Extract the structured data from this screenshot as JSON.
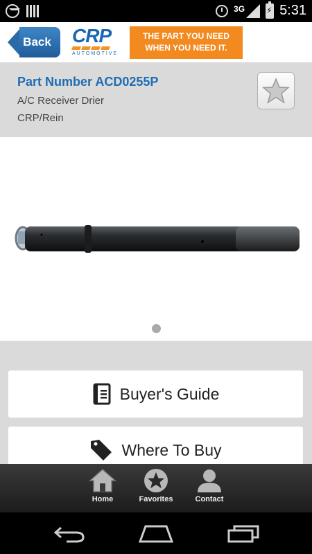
{
  "status_bar": {
    "network": "3G",
    "time": "5:31"
  },
  "header": {
    "back_label": "Back",
    "logo": {
      "name": "CRP",
      "subtitle": "AUTOMOTIVE"
    },
    "tagline_line1": "THE PART YOU NEED",
    "tagline_line2": "WHEN YOU NEED IT."
  },
  "part": {
    "number_label": "Part Number ACD0255P",
    "description": "A/C Receiver Drier",
    "brand": "CRP/Rein"
  },
  "gallery": {
    "current_page": 1,
    "total_pages": 1
  },
  "actions": {
    "buyers_guide": "Buyer's Guide",
    "where_to_buy": "Where To Buy"
  },
  "tabs": [
    {
      "label": "Home",
      "icon": "home-icon"
    },
    {
      "label": "Favorites",
      "icon": "star-icon"
    },
    {
      "label": "Contact",
      "icon": "person-icon"
    }
  ],
  "colors": {
    "accent_blue": "#1f6db3",
    "brand_orange": "#f28a1f",
    "panel_gray": "#dadada"
  }
}
